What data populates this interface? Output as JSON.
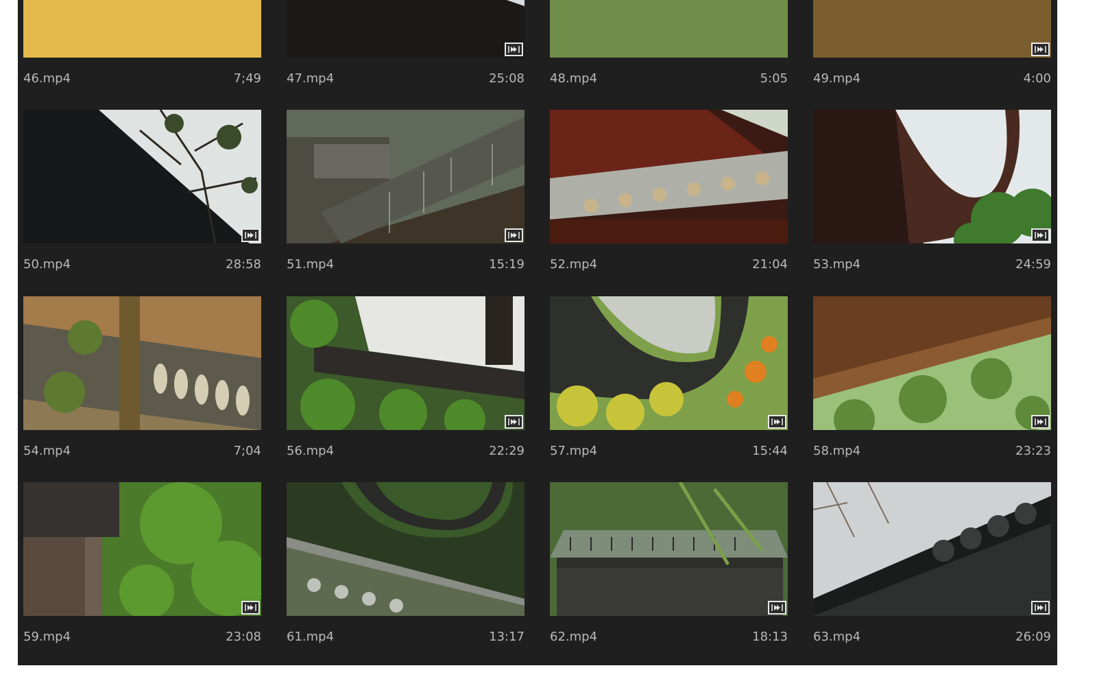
{
  "clips": [
    {
      "name": "46.mp4",
      "duration": "7;49",
      "thumbnail_icon": "golden-eave-wall-thumbnail",
      "badge_icon": ""
    },
    {
      "name": "47.mp4",
      "duration": "25:08",
      "thumbnail_icon": "dark-eave-blossom-thumbnail",
      "badge_icon": "audio-video-badge-icon"
    },
    {
      "name": "48.mp4",
      "duration": "5:05",
      "thumbnail_icon": "tiled-ridge-yellow-flowers-thumbnail",
      "badge_icon": ""
    },
    {
      "name": "49.mp4",
      "duration": "4:00",
      "thumbnail_icon": "sunlit-brick-eave-thumbnail",
      "badge_icon": "audio-video-badge-icon"
    },
    {
      "name": "50.mp4",
      "duration": "28:58",
      "thumbnail_icon": "dark-roof-tree-thumbnail",
      "badge_icon": "audio-video-badge-icon"
    },
    {
      "name": "51.mp4",
      "duration": "15:19",
      "thumbnail_icon": "rainy-wall-roof-thumbnail",
      "badge_icon": "audio-video-badge-icon"
    },
    {
      "name": "52.mp4",
      "duration": "21:04",
      "thumbnail_icon": "red-painted-eave-thumbnail",
      "badge_icon": ""
    },
    {
      "name": "53.mp4",
      "duration": "24:59",
      "thumbnail_icon": "upturned-eave-sky-thumbnail",
      "badge_icon": "audio-video-badge-icon"
    },
    {
      "name": "54.mp4",
      "duration": "7;04",
      "thumbnail_icon": "ornate-ridge-tiles-thumbnail",
      "badge_icon": ""
    },
    {
      "name": "56.mp4",
      "duration": "22:29",
      "thumbnail_icon": "white-wall-greenery-thumbnail",
      "badge_icon": "audio-video-badge-icon"
    },
    {
      "name": "57.mp4",
      "duration": "15:44",
      "thumbnail_icon": "curved-roof-autumn-leaves-thumbnail",
      "badge_icon": "audio-video-badge-icon"
    },
    {
      "name": "58.mp4",
      "duration": "23:23",
      "thumbnail_icon": "wooden-eave-rain-thumbnail",
      "badge_icon": "audio-video-badge-icon"
    },
    {
      "name": "59.mp4",
      "duration": "23:08",
      "thumbnail_icon": "brick-house-trees-thumbnail",
      "badge_icon": "audio-video-badge-icon"
    },
    {
      "name": "61.mp4",
      "duration": "13:17",
      "thumbnail_icon": "mossy-curved-roof-thumbnail",
      "badge_icon": ""
    },
    {
      "name": "62.mp4",
      "duration": "18:13",
      "thumbnail_icon": "pavilion-bamboo-thumbnail",
      "badge_icon": "audio-video-badge-icon"
    },
    {
      "name": "63.mp4",
      "duration": "26:09",
      "thumbnail_icon": "black-roof-ridge-branches-thumbnail",
      "badge_icon": "audio-video-badge-icon"
    }
  ],
  "colors": {
    "panel_background": "#1f1f1f",
    "label_text": "#b9b9b9",
    "badge_border": "#e8e8e8"
  }
}
